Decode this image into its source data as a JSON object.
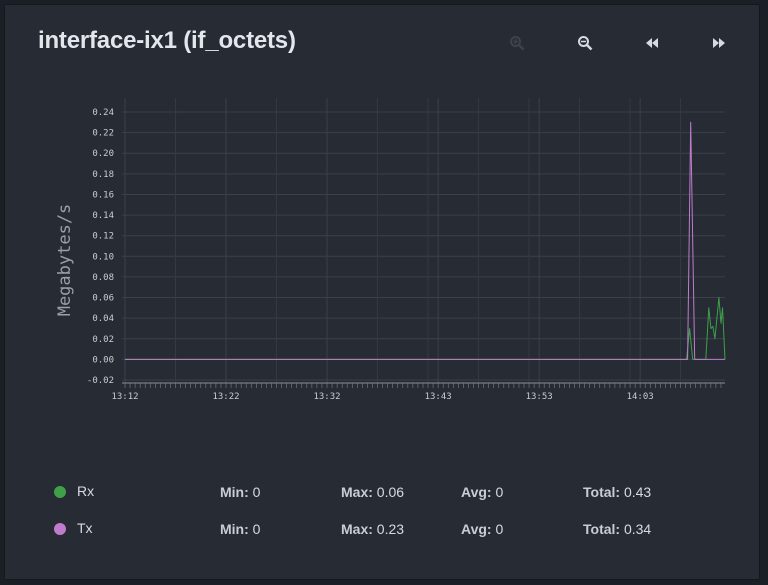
{
  "panel": {
    "title": "interface-ix1 (if_octets)"
  },
  "toolbar": {
    "zoom_in_icon": "zoom-in-icon",
    "zoom_out_icon": "zoom-out-icon",
    "back_icon": "rewind-icon",
    "forward_icon": "fast-forward-icon"
  },
  "chart_data": {
    "type": "line",
    "ylabel": "Megabytes/s",
    "ylim": [
      -0.02,
      0.24
    ],
    "yticks": [
      "0.24",
      "0.22",
      "0.20",
      "0.18",
      "0.16",
      "0.14",
      "0.12",
      "0.10",
      "0.08",
      "0.06",
      "0.04",
      "0.02",
      "0.00",
      "-0.02"
    ],
    "ytick_values": [
      0.24,
      0.22,
      0.2,
      0.18,
      0.16,
      0.14,
      0.12,
      0.1,
      0.08,
      0.06,
      0.04,
      0.02,
      0.0,
      -0.02
    ],
    "xticks": [
      "13:12",
      "13:22",
      "13:32",
      "13:43",
      "13:53",
      "14:03"
    ],
    "xtick_minutes": [
      0,
      10,
      20,
      31,
      41,
      51
    ],
    "xlim_minutes": [
      0,
      59.4
    ],
    "grid": true,
    "series": [
      {
        "name": "Rx",
        "color": "#3fa04a",
        "points": [
          [
            0,
            0
          ],
          [
            55.6,
            0
          ],
          [
            55.9,
            0.03
          ],
          [
            56.2,
            0
          ],
          [
            57.5,
            0
          ],
          [
            57.8,
            0.05
          ],
          [
            58.0,
            0.03
          ],
          [
            58.2,
            0.032
          ],
          [
            58.4,
            0.02
          ],
          [
            58.6,
            0.04
          ],
          [
            58.8,
            0.06
          ],
          [
            59.0,
            0.035
          ],
          [
            59.15,
            0.05
          ],
          [
            59.4,
            0
          ]
        ]
      },
      {
        "name": "Tx",
        "color": "#c07ccc",
        "points": [
          [
            0,
            0
          ],
          [
            55.7,
            0
          ],
          [
            56.0,
            0.23
          ],
          [
            56.4,
            0
          ],
          [
            59.4,
            0
          ]
        ]
      }
    ]
  },
  "legend": [
    {
      "name": "Rx",
      "color": "#3fa04a",
      "min_label": "Min:",
      "min": "0",
      "max_label": "Max:",
      "max": "0.06",
      "avg_label": "Avg:",
      "avg": "0",
      "total_label": "Total:",
      "total": "0.43"
    },
    {
      "name": "Tx",
      "color": "#c07ccc",
      "min_label": "Min:",
      "min": "0",
      "max_label": "Max:",
      "max": "0.23",
      "avg_label": "Avg:",
      "avg": "0",
      "total_label": "Total:",
      "total": "0.34"
    }
  ]
}
